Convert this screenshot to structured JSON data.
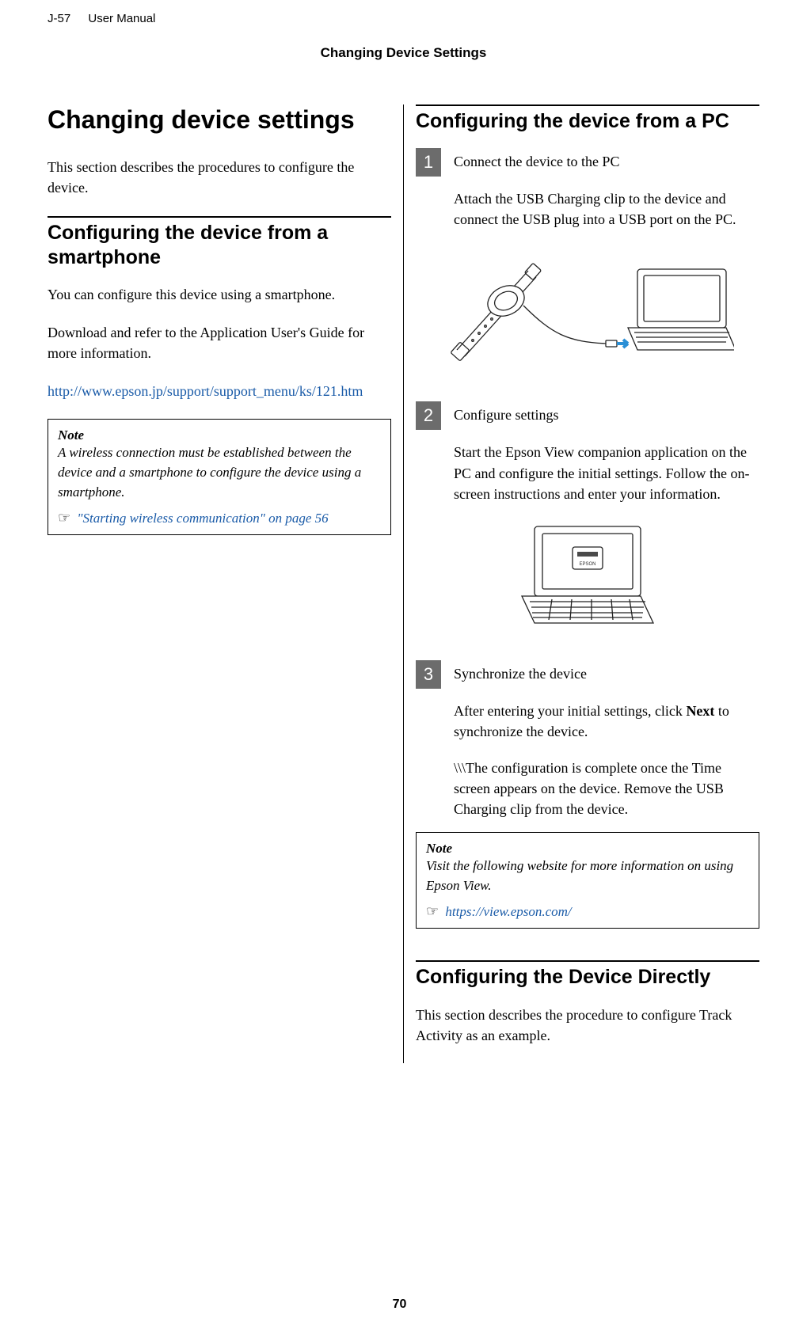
{
  "header": {
    "model": "J-57",
    "doc_type": "User Manual",
    "section_title": "Changing Device Settings"
  },
  "left_column": {
    "h1": "Changing device settings",
    "intro": "This section describes the procedures to configure the device.",
    "h2": "Configuring the device from a smartphone",
    "p1": "You can configure this device using a smartphone.",
    "p2": "Download and refer to the Application User's Guide for more information.",
    "url": "http://www.epson.jp/support/support_menu/ks/121.htm",
    "note": {
      "label": "Note",
      "text": "A wireless connection must be established between the device and a smartphone to configure the device using a smartphone.",
      "icon": "☞",
      "link_text": "\"Starting wireless communication\" on page 56"
    }
  },
  "right_column": {
    "h2_a": "Configuring the device from a PC",
    "step1": {
      "num": "1",
      "title": "Connect the device to the PC",
      "desc": "Attach the USB Charging clip to the device and connect the USB plug into a USB port on the PC."
    },
    "step2": {
      "num": "2",
      "title": "Configure settings",
      "desc": "Start the Epson View companion application on the PC and configure the initial settings. Follow the on-screen instructions and enter your information."
    },
    "step3": {
      "num": "3",
      "title": "Synchronize the device",
      "desc_a_pre": "After entering your initial settings, click ",
      "desc_a_bold": "Next",
      "desc_a_post": " to synchronize the device.",
      "desc_b": "\\\\\\The configuration is complete once the Time screen appears on the device. Remove the USB Charging clip from the device."
    },
    "note": {
      "label": "Note",
      "text": "Visit the following website for more information on using Epson View.",
      "icon": "☞",
      "link_text": "https://view.epson.com/"
    },
    "h2_b": "Configuring the Device Directly",
    "p_b": "This section describes the procedure to configure Track Activity as an example."
  },
  "page_number": "70"
}
